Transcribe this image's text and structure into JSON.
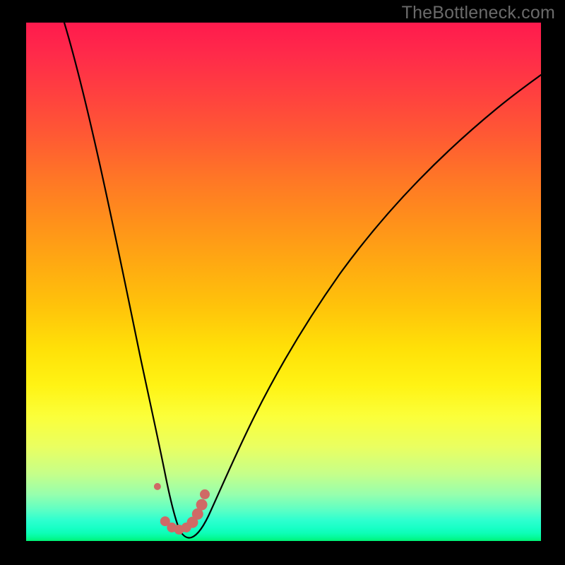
{
  "watermark": "TheBottleneck.com",
  "colors": {
    "background": "#000000",
    "curve": "#000000",
    "marker": "#cf6a66",
    "gradient_top": "#ff1a4d",
    "gradient_bottom": "#00f374"
  },
  "chart_data": {
    "type": "line",
    "title": "",
    "xlabel": "",
    "ylabel": "",
    "xlim": [
      0,
      100
    ],
    "ylim": [
      0,
      100
    ],
    "series": [
      {
        "name": "bottleneck-curve",
        "x": [
          6,
          8,
          10,
          12,
          14,
          16,
          18,
          20,
          22,
          24,
          25,
          26,
          27,
          28,
          29,
          30,
          31,
          32,
          33,
          34,
          36,
          38,
          40,
          43,
          46,
          50,
          55,
          60,
          66,
          72,
          80,
          88,
          96,
          100
        ],
        "y": [
          100,
          90,
          80,
          71,
          62,
          53,
          45,
          37,
          29,
          21,
          16,
          12,
          8,
          5,
          3,
          2,
          2,
          3,
          4,
          6,
          10,
          14,
          19,
          25,
          31,
          38,
          46,
          53,
          60,
          66,
          73,
          79,
          84,
          86
        ]
      }
    ],
    "markers": {
      "name": "highlighted-points",
      "color": "#cf6a66",
      "points": [
        {
          "x": 25.5,
          "y": 10.5,
          "r": 5
        },
        {
          "x": 27.0,
          "y": 3.8,
          "r": 7
        },
        {
          "x": 28.3,
          "y": 2.6,
          "r": 7
        },
        {
          "x": 29.7,
          "y": 2.2,
          "r": 7
        },
        {
          "x": 31.1,
          "y": 2.6,
          "r": 7
        },
        {
          "x": 32.3,
          "y": 3.6,
          "r": 8
        },
        {
          "x": 33.3,
          "y": 5.2,
          "r": 8
        },
        {
          "x": 34.1,
          "y": 7.0,
          "r": 8
        },
        {
          "x": 34.7,
          "y": 9.0,
          "r": 7
        }
      ]
    }
  }
}
